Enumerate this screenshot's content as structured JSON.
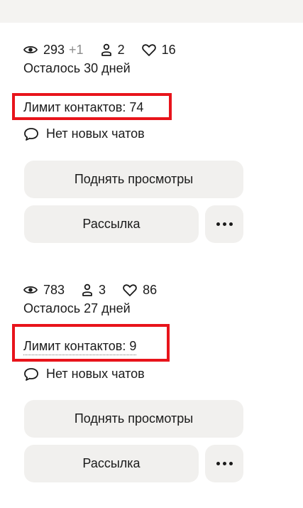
{
  "listings": [
    {
      "views": "293",
      "views_delta": "+1",
      "contacts": "2",
      "favorites": "16",
      "days_left": "Осталось 30 дней",
      "contact_limit": "Лимит контактов: 74",
      "chats": "Нет новых чатов",
      "boost_label": "Поднять просмотры",
      "mailing_label": "Рассылка"
    },
    {
      "views": "783",
      "contacts": "3",
      "favorites": "86",
      "days_left": "Осталось 27 дней",
      "contact_limit": "Лимит контактов: 9",
      "chats": "Нет новых чатов",
      "boost_label": "Поднять просмотры",
      "mailing_label": "Рассылка"
    }
  ],
  "icons": {
    "views": "eye-icon",
    "contacts": "person-icon",
    "favorites": "heart-icon",
    "chats": "chat-bubble-icon",
    "more": "more-dots-icon"
  },
  "colors": {
    "highlight_border": "#e8141b",
    "button_bg": "#f1f0ee",
    "delta_text": "#8c8c8c"
  }
}
